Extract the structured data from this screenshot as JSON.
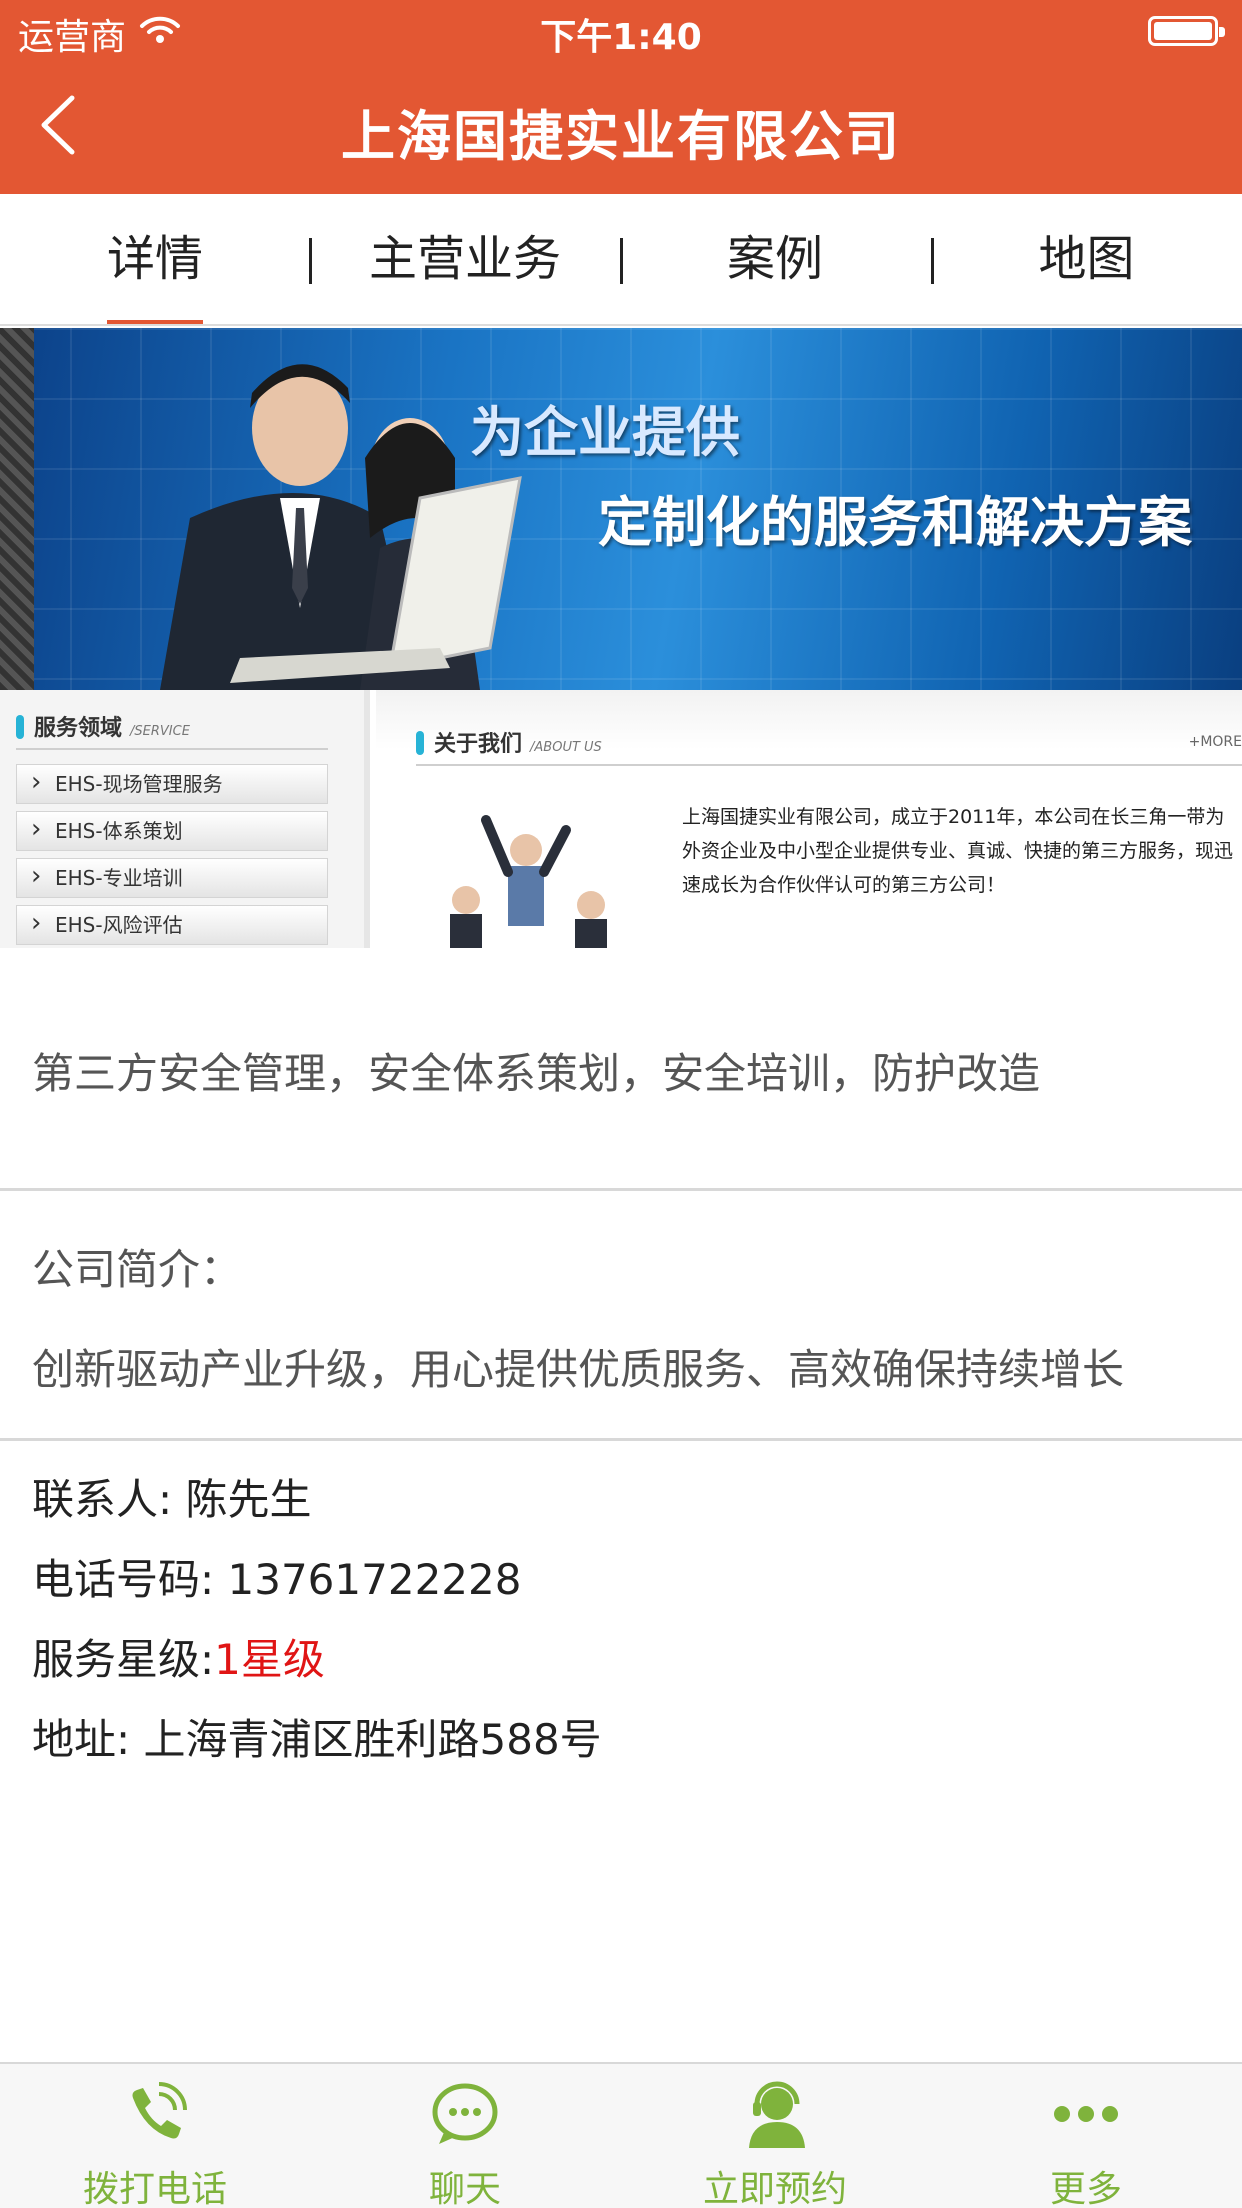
{
  "status_bar": {
    "carrier": "运营商",
    "time": "下午1:40"
  },
  "header": {
    "title": "上海国捷实业有限公司",
    "back_icon": "chevron-left-icon"
  },
  "tabs": [
    {
      "label": "详情",
      "active": true
    },
    {
      "label": "主营业务",
      "active": false
    },
    {
      "label": "案例",
      "active": false
    },
    {
      "label": "地图",
      "active": false
    }
  ],
  "banner": {
    "line1": "为企业提供",
    "line2": "定制化的服务和解决方案"
  },
  "site_preview": {
    "left_title": "服务领域",
    "left_title_en": "/SERVICE",
    "menu": [
      "EHS-现场管理服务",
      "EHS-体系策划",
      "EHS-专业培训",
      "EHS-风险评估"
    ],
    "right_title": "关于我们",
    "right_title_en": "/ABOUT US",
    "more": "+MORE",
    "paragraph": "上海国捷实业有限公司，成立于2011年，本公司在长三角一带为外资企业及中小型企业提供专业、真诚、快捷的第三方服务，现迅速成长为合作伙伴认可的第三方公司！"
  },
  "summary": "第三方安全管理，安全体系策划，安全培训，防护改造",
  "intro": {
    "label": "公司简介：",
    "text": "创新驱动产业升级，用心提供优质服务、高效确保持续增长"
  },
  "contact": {
    "person_label": "联系人: ",
    "person": "陈先生",
    "phone_label": "电话号码: ",
    "phone": "13761722228",
    "rating_label": "服务星级:",
    "rating": "1星级",
    "address_label": "地址: ",
    "address": "上海青浦区胜利路588号"
  },
  "bottom_bar": [
    {
      "label": "拨打电话",
      "icon": "phone-icon"
    },
    {
      "label": "聊天",
      "icon": "chat-bubble-icon"
    },
    {
      "label": "立即预约",
      "icon": "customer-service-icon"
    },
    {
      "label": "更多",
      "icon": "more-dots-icon"
    }
  ],
  "colors": {
    "header": "#e35733",
    "accent_green": "#7fb33c",
    "rating_red": "#e01515"
  }
}
